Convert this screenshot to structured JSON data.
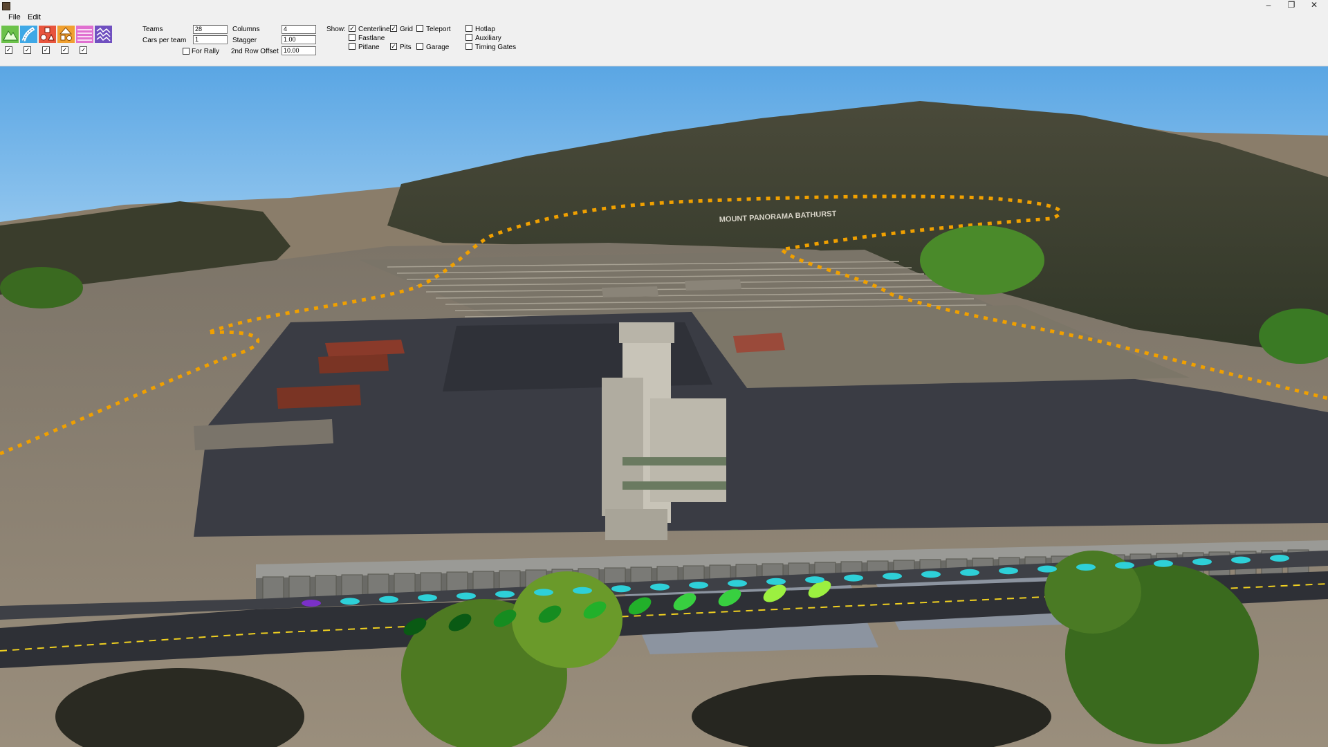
{
  "window": {
    "minimize": "–",
    "maximize": "❐",
    "close": "✕"
  },
  "menu": [
    {
      "label": "File"
    },
    {
      "label": "Edit"
    }
  ],
  "toolbar": {
    "tools": [
      {
        "name": "terrain-tool",
        "icon": "mountain-icon",
        "color": "#6cc24a"
      },
      {
        "name": "road-tool",
        "icon": "road-icon",
        "color": "#3ea8e6"
      },
      {
        "name": "objects-tool",
        "icon": "objects-icon",
        "color": "#e8553e"
      },
      {
        "name": "shapes-tool",
        "icon": "shapes-icon",
        "color": "#f0a030"
      },
      {
        "name": "textures-tool",
        "icon": "texture-icon",
        "color": "#e070d0"
      },
      {
        "name": "flags-tool",
        "icon": "checkered-flag-icon",
        "color": "#7050c0"
      }
    ],
    "tool_checks": [
      true,
      true,
      true,
      true,
      true
    ],
    "check_mark": "✓"
  },
  "grid_settings": {
    "teams_label": "Teams",
    "teams_value": "28",
    "cars_per_team_label": "Cars per team",
    "cars_per_team_value": "1",
    "for_rally_label": "For Rally",
    "for_rally_checked": false,
    "columns_label": "Columns",
    "columns_value": "4",
    "stagger_label": "Stagger",
    "stagger_value": "1.00",
    "second_row_offset_label": "2nd Row Offset",
    "second_row_offset_value": "10.00"
  },
  "show": {
    "label": "Show:",
    "centerline": {
      "label": "Centerline",
      "checked": true
    },
    "fastlane": {
      "label": "Fastlane",
      "checked": false
    },
    "pitlane": {
      "label": "Pitlane",
      "checked": false
    },
    "grid": {
      "label": "Grid",
      "checked": true
    },
    "pits": {
      "label": "Pits",
      "checked": true
    },
    "teleport": {
      "label": "Teleport",
      "checked": false
    },
    "garage": {
      "label": "Garage",
      "checked": false
    },
    "hotlap": {
      "label": "Hotlap",
      "checked": false
    },
    "auxiliary": {
      "label": "Auxiliary",
      "checked": false
    },
    "timing_gates": {
      "label": "Timing Gates",
      "checked": false
    }
  },
  "scene": {
    "sky_color": "#6fb3e8",
    "ground_color": "#8c8070",
    "tarmac_color": "#3a3c44",
    "track_line_color": "#f0a000",
    "grid_car_colors": [
      "#0a5a14",
      "#168c20",
      "#22b02a",
      "#38d040",
      "#9cf040"
    ],
    "pit_car_color": "#2ed0d8",
    "hill_sign": "MOUNT PANORAMA BATHURST"
  }
}
